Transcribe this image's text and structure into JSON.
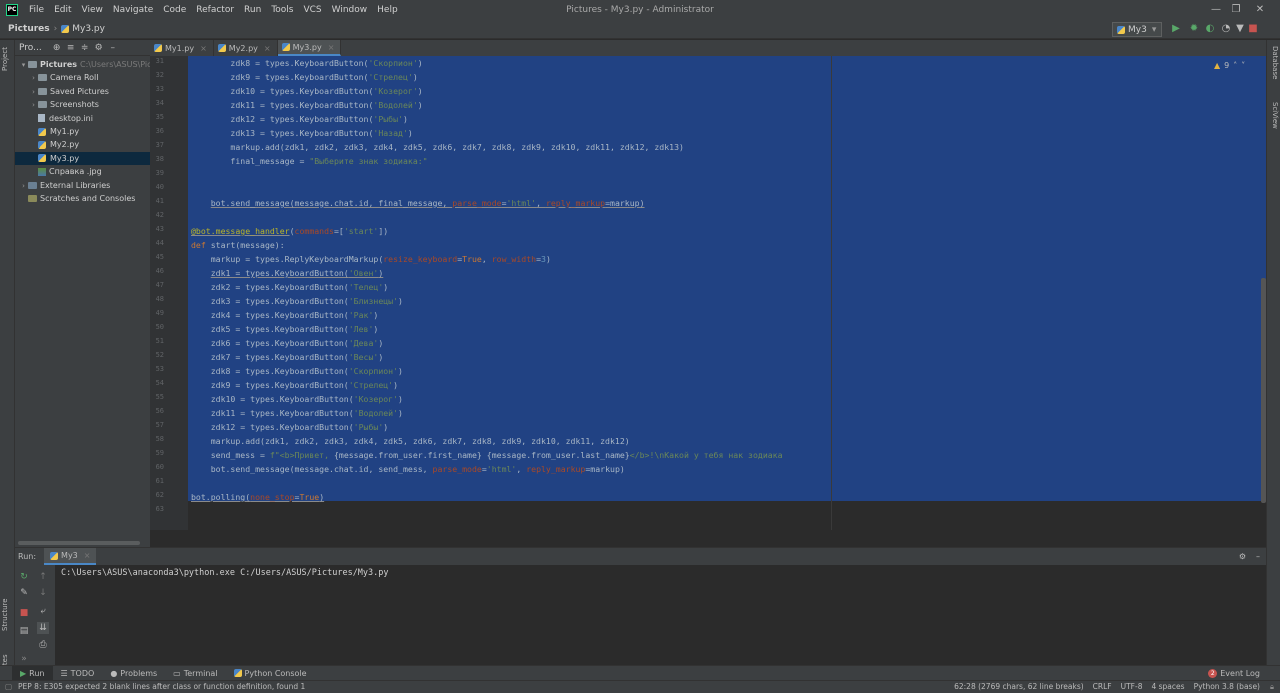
{
  "app": {
    "logo_text": "PC",
    "window_title": "Pictures - My3.py - Administrator",
    "menu": [
      "File",
      "Edit",
      "View",
      "Navigate",
      "Code",
      "Refactor",
      "Run",
      "Tools",
      "VCS",
      "Window",
      "Help"
    ]
  },
  "navbar": {
    "crumb_root": "Pictures",
    "crumb_file": "My3.py",
    "run_config": "My3"
  },
  "project": {
    "header_label": "Pro...",
    "tree": [
      {
        "label": "Pictures",
        "hint": "C:\\Users\\ASUS\\Pictures",
        "type": "folder",
        "level": 0,
        "expanded": true
      },
      {
        "label": "Camera Roll",
        "type": "folder",
        "level": 1
      },
      {
        "label": "Saved Pictures",
        "type": "folder",
        "level": 1
      },
      {
        "label": "Screenshots",
        "type": "folder",
        "level": 1
      },
      {
        "label": "desktop.ini",
        "type": "file",
        "level": 1
      },
      {
        "label": "My1.py",
        "type": "py",
        "level": 1
      },
      {
        "label": "My2.py",
        "type": "py",
        "level": 1
      },
      {
        "label": "My3.py",
        "type": "py",
        "level": 1,
        "selected": true
      },
      {
        "label": "Справка .jpg",
        "type": "img",
        "level": 1
      },
      {
        "label": "External Libraries",
        "type": "lib",
        "level": 0
      },
      {
        "label": "Scratches and Consoles",
        "type": "scratch",
        "level": 0
      }
    ]
  },
  "tabs": [
    {
      "label": "My1.py",
      "active": false
    },
    {
      "label": "My2.py",
      "active": false
    },
    {
      "label": "My3.py",
      "active": true
    }
  ],
  "editor": {
    "inspection_count": "9",
    "lines": [
      {
        "n": "31",
        "html": "        zdk8 = types.KeyboardButton(<span class=\"str\">'Скорпион'</span>)"
      },
      {
        "n": "32",
        "html": "        zdk9 = types.KeyboardButton(<span class=\"str\">'Стрелец'</span>)"
      },
      {
        "n": "33",
        "html": "        zdk10 = types.KeyboardButton(<span class=\"str\">'Козерог'</span>)"
      },
      {
        "n": "34",
        "html": "        zdk11 = types.KeyboardButton(<span class=\"str\">'Водолей'</span>)"
      },
      {
        "n": "35",
        "html": "        zdk12 = types.KeyboardButton(<span class=\"str\">'Рыбы'</span>)"
      },
      {
        "n": "36",
        "html": "        zdk13 = types.KeyboardButton(<span class=\"str\">'Назад'</span>)"
      },
      {
        "n": "37",
        "html": "        markup.add(zdk1, zdk2, zdk3, zdk4, zdk5, zdk6, zdk7, zdk8, zdk9, zdk10, zdk11, zdk12, zdk13)"
      },
      {
        "n": "38",
        "html": "        final_message = <span class=\"str\">\"Выберите знак зодиака:\"</span>"
      },
      {
        "n": "39",
        "html": ""
      },
      {
        "n": "40",
        "html": ""
      },
      {
        "n": "41",
        "html": "    <span class=\"u\">bot.send_message(message.chat.id, final_message, <span class=\"par\">parse_mode</span>=<span class=\"str\">'html'</span>, <span class=\"par\">reply_markup</span>=markup)</span>"
      },
      {
        "n": "42",
        "html": ""
      },
      {
        "n": "43",
        "html": "<span class=\"dec u\">@bot.message_handler</span>(<span class=\"par\">commands</span>=[<span class=\"str\">'start'</span>])"
      },
      {
        "n": "44",
        "html": "<span class=\"kw\">def</span> start(message):"
      },
      {
        "n": "45",
        "html": "    markup = types.ReplyKeyboardMarkup(<span class=\"par\">resize_keyboard</span>=<span class=\"kw\">True</span>, <span class=\"par\">row_width</span>=<span class=\"num\">3</span>)"
      },
      {
        "n": "46",
        "html": "    <span class=\"u\">zdk1 = types.KeyboardButton(<span class=\"str\">'Овен'</span>)</span>"
      },
      {
        "n": "47",
        "html": "    zdk2 = types.KeyboardButton(<span class=\"str\">'Телец'</span>)"
      },
      {
        "n": "48",
        "html": "    zdk3 = types.KeyboardButton(<span class=\"str\">'Близнецы'</span>)"
      },
      {
        "n": "49",
        "html": "    zdk4 = types.KeyboardButton(<span class=\"str\">'Рак'</span>)"
      },
      {
        "n": "50",
        "html": "    zdk5 = types.KeyboardButton(<span class=\"str\">'Лев'</span>)"
      },
      {
        "n": "51",
        "html": "    zdk6 = types.KeyboardButton(<span class=\"str\">'Дева'</span>)"
      },
      {
        "n": "52",
        "html": "    zdk7 = types.KeyboardButton(<span class=\"str\">'Весы'</span>)"
      },
      {
        "n": "53",
        "html": "    zdk8 = types.KeyboardButton(<span class=\"str\">'Скорпион'</span>)"
      },
      {
        "n": "54",
        "html": "    zdk9 = types.KeyboardButton(<span class=\"str\">'Стрелец'</span>)"
      },
      {
        "n": "55",
        "html": "    zdk10 = types.KeyboardButton(<span class=\"str\">'Козерог'</span>)"
      },
      {
        "n": "56",
        "html": "    zdk11 = types.KeyboardButton(<span class=\"str\">'Водолей'</span>)"
      },
      {
        "n": "57",
        "html": "    zdk12 = types.KeyboardButton(<span class=\"str\">'Рыбы'</span>)"
      },
      {
        "n": "58",
        "html": "    markup.add(zdk1, zdk2, zdk3, zdk4, zdk5, zdk6, zdk7, zdk8, zdk9, zdk10, zdk11, zdk12)"
      },
      {
        "n": "59",
        "html": "    send_mess = <span class=\"str\">f\"&lt;b&gt;Привет, </span>{message.from_user.first_name} {message.from_user.last_name}<span class=\"str\">&lt;/b&gt;!\\nКакой у тебя нак зодиака</span>"
      },
      {
        "n": "60",
        "html": "    bot.send_message(message.chat.id, send_mess, <span class=\"par\">parse_mode</span>=<span class=\"str\">'html'</span>, <span class=\"par\">reply_markup</span>=markup)"
      },
      {
        "n": "61",
        "html": ""
      },
      {
        "n": "62",
        "html": "<span class=\"u\">bot.polling(<span class=\"par\">none_stop</span>=<span class=\"kw\">True</span>)</span>"
      },
      {
        "n": "63",
        "html": ""
      }
    ]
  },
  "side_tabs": {
    "left_top": "Project",
    "left_mid": "Structure",
    "left_bottom": "Favorites",
    "right_top": "Database",
    "right_mid": "SciView"
  },
  "run": {
    "label": "Run:",
    "tab": "My3",
    "console": "C:\\Users\\ASUS\\anaconda3\\python.exe C:/Users/ASUS/Pictures/My3.py"
  },
  "toolwindows": {
    "run": "Run",
    "todo": "TODO",
    "problems": "Problems",
    "terminal": "Terminal",
    "python_console": "Python Console",
    "event_log": "Event Log",
    "event_count": "2"
  },
  "status": {
    "message": "PEP 8: E305 expected 2 blank lines after class or function definition, found 1",
    "position": "62:28 (2769 chars, 62 line breaks)",
    "line_sep": "CRLF",
    "encoding": "UTF-8",
    "indent": "4 spaces",
    "interpreter": "Python 3.8 (base)"
  },
  "colors": {
    "selection": "#214283",
    "background": "#2b2b2b",
    "panel": "#3c3f41",
    "accent": "#4a88c7"
  }
}
